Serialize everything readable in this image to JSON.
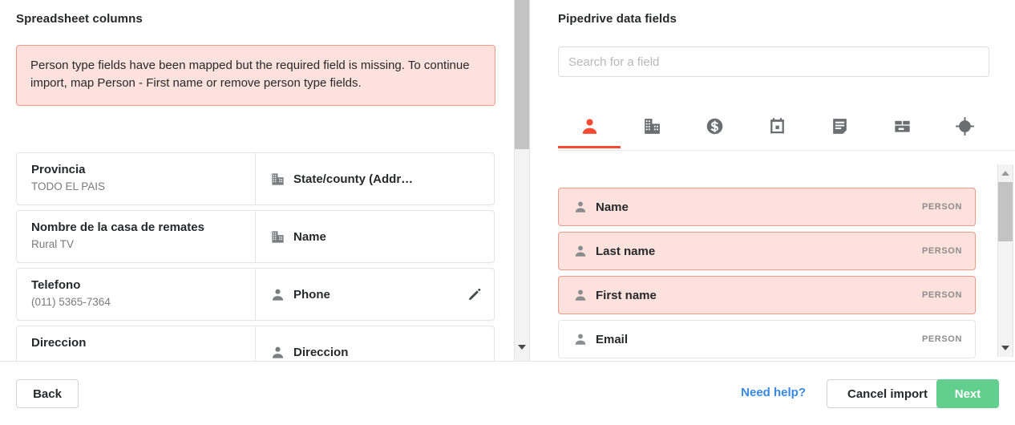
{
  "left": {
    "title": "Spreadsheet columns",
    "warning": "Person type fields have been mapped but the required field is missing. To continue import, map Person - First name or remove person type fields.",
    "rows": [
      {
        "source": "Provincia",
        "sample": "TODO EL PAIS",
        "target": "State/county (Addr…",
        "target_icon": "organization-icon",
        "editable": false
      },
      {
        "source": "Nombre de la casa de remates",
        "sample": "Rural TV",
        "target": "Name",
        "target_icon": "organization-icon",
        "editable": false
      },
      {
        "source": "Telefono",
        "sample": "(011) 5365-7364",
        "target": "Phone",
        "target_icon": "person-icon",
        "editable": true
      },
      {
        "source": "Direccion",
        "sample": "",
        "target": "Direccion",
        "target_icon": "person-icon",
        "editable": false
      }
    ]
  },
  "right": {
    "title": "Pipedrive data fields",
    "search_placeholder": "Search for a field",
    "search_value": "",
    "tabs": [
      {
        "name": "person-tab",
        "icon": "person-icon",
        "active": true
      },
      {
        "name": "organization-tab",
        "icon": "organization-icon",
        "active": false
      },
      {
        "name": "deal-tab",
        "icon": "dollar-coin-icon",
        "active": false
      },
      {
        "name": "activity-tab",
        "icon": "calendar-icon",
        "active": false
      },
      {
        "name": "note-tab",
        "icon": "note-icon",
        "active": false
      },
      {
        "name": "product-tab",
        "icon": "product-box-icon",
        "active": false
      },
      {
        "name": "lead-tab",
        "icon": "target-icon",
        "active": false
      }
    ],
    "fields": [
      {
        "label": "Name",
        "badge": "PERSON",
        "highlighted": true
      },
      {
        "label": "Last name",
        "badge": "PERSON",
        "highlighted": true
      },
      {
        "label": "First name",
        "badge": "PERSON",
        "highlighted": true
      },
      {
        "label": "Email",
        "badge": "PERSON",
        "highlighted": false
      }
    ]
  },
  "footer": {
    "back": "Back",
    "need_help": "Need help?",
    "cancel": "Cancel import",
    "next": "Next"
  },
  "colors": {
    "accent_red": "#f44a32",
    "warning_bg": "#fde1dc",
    "warning_border": "#f09a87",
    "link_blue": "#3788e5",
    "next_green": "#62cf8e"
  }
}
